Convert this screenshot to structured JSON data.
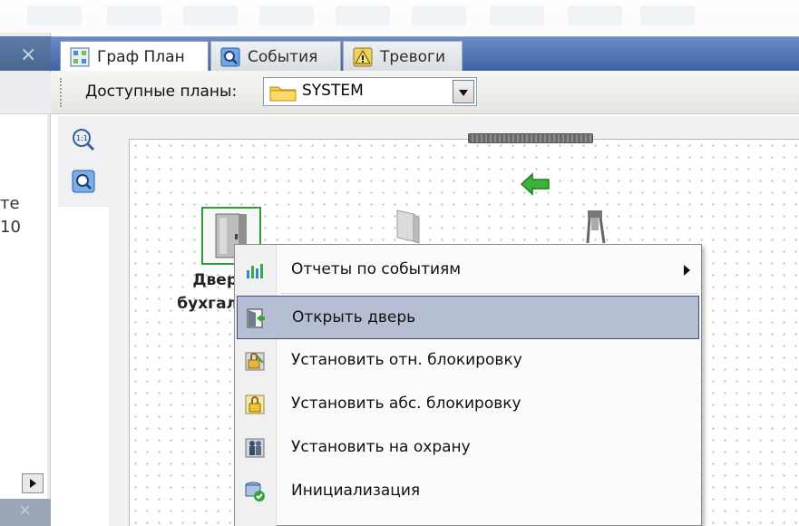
{
  "left_panel": {
    "text_lines": [
      "те",
      "10"
    ],
    "close_glyph": "×"
  },
  "tabs": [
    {
      "label": "Граф План",
      "icon": "grid-plan-icon",
      "active": true
    },
    {
      "label": "События",
      "icon": "events-icon",
      "active": false
    },
    {
      "label": "Тревоги",
      "icon": "alarm-warning-icon",
      "active": false
    }
  ],
  "plans_bar": {
    "label": "Доступные планы:",
    "selected_plan": "SYSTEM",
    "selected_icon": "folder-icon"
  },
  "tools": [
    {
      "name": "zoom-1-1-icon"
    },
    {
      "name": "zoom-fit-icon"
    }
  ],
  "canvas": {
    "door_label_lines": [
      "Двер",
      "бухгал"
    ]
  },
  "context_menu": {
    "items": [
      {
        "label": "Отчеты по событиям",
        "icon": "reports-chart-icon",
        "submenu": true,
        "highlighted": false
      },
      {
        "label": "Открыть дверь",
        "icon": "open-door-icon",
        "submenu": false,
        "highlighted": true
      },
      {
        "label": "Установить отн. блокировку",
        "icon": "relative-lock-icon",
        "submenu": false,
        "highlighted": false
      },
      {
        "label": "Установить абс. блокировку",
        "icon": "absolute-lock-icon",
        "submenu": false,
        "highlighted": false
      },
      {
        "label": "Установить на охрану",
        "icon": "arm-guard-icon",
        "submenu": false,
        "highlighted": false
      },
      {
        "label": "Инициализация",
        "icon": "initialize-icon",
        "submenu": false,
        "highlighted": false
      }
    ]
  },
  "colors": {
    "tabbar": "#3d63a8",
    "menu_highlight": "#b6bed4",
    "door_border": "#2e9c3a"
  }
}
